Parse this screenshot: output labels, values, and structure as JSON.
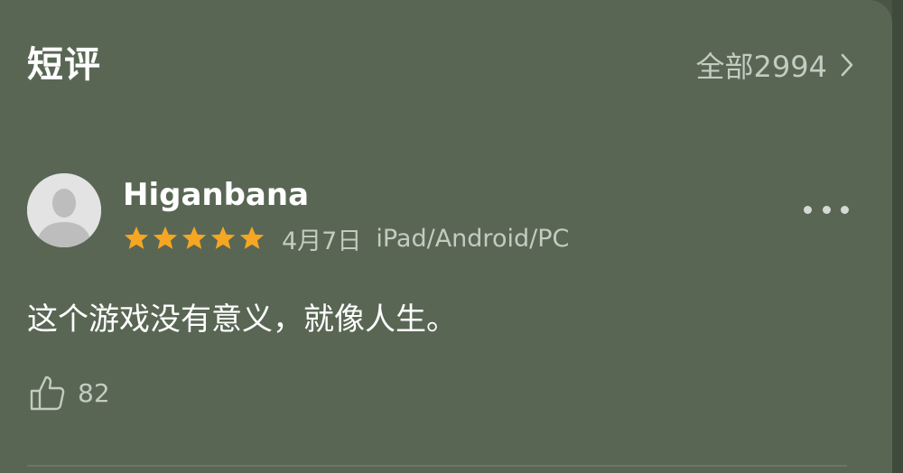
{
  "section": {
    "title": "短评",
    "view_all_label": "全部2994"
  },
  "review": {
    "username": "Higanbana",
    "rating": 5,
    "rating_max": 5,
    "date": "4月7日",
    "device": "iPad/Android/PC",
    "content": "这个游戏没有意义，就像人生。",
    "like_count": "82"
  },
  "icons": {
    "view_all": "chevron-right-icon",
    "avatar": "default-avatar-icon",
    "star": "star-icon",
    "more": "more-dots-icon",
    "like": "thumbs-up-icon"
  },
  "colors": {
    "background": "#596654",
    "star": "#f5a623",
    "primary_text": "#ffffff",
    "secondary_text": "#c4cbc1"
  }
}
